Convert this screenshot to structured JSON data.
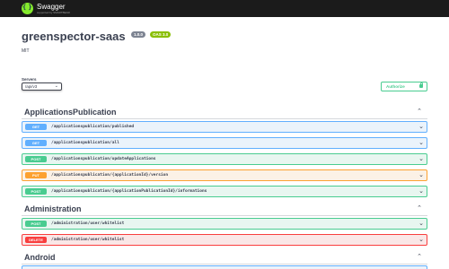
{
  "topbar": {
    "logo_name": "Swagger",
    "logo_sub": "supported by SMARTBEAR",
    "logo_icon": "swagger-logo-icon"
  },
  "info": {
    "title": "greenspector-saas",
    "version": "1.0.0",
    "oas": "OAS 3.0",
    "license": "MIT"
  },
  "servers": {
    "label": "Servers",
    "selected": "/api/v3"
  },
  "authorize": {
    "label": "Authorize",
    "icon": "lock-icon"
  },
  "colors": {
    "get": "#61affe",
    "post": "#49cc90",
    "put": "#fca130",
    "delete": "#f93e3e",
    "topbar": "#1b1b1b"
  },
  "tags": [
    {
      "name": "ApplicationsPublication",
      "operations": [
        {
          "method": "GET",
          "path": "/applicationspublication/published"
        },
        {
          "method": "GET",
          "path": "/applicationspublication/all"
        },
        {
          "method": "POST",
          "path": "/applicationspublication/updateApplications"
        },
        {
          "method": "PUT",
          "path": "/applicationspublication/{applicationId}/version"
        },
        {
          "method": "POST",
          "path": "/applicationspublication/{applicationPublicationId}/informations"
        }
      ]
    },
    {
      "name": "Administration",
      "operations": [
        {
          "method": "POST",
          "path": "/administration/user/whitelist"
        },
        {
          "method": "DELETE",
          "path": "/administration/user/whitelist"
        }
      ]
    },
    {
      "name": "Android",
      "operations": []
    }
  ]
}
